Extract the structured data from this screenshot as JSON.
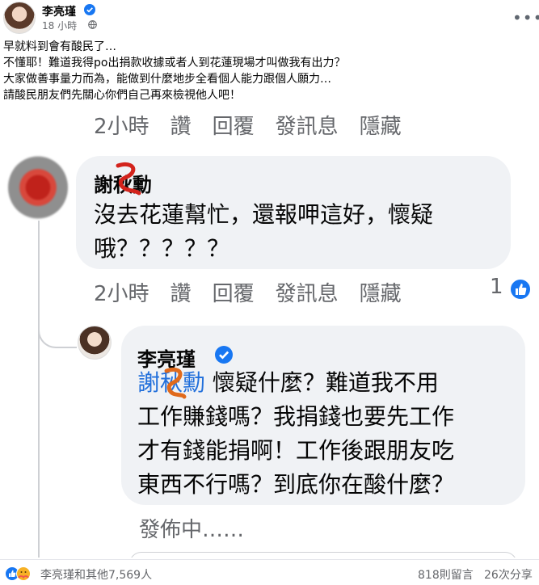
{
  "post": {
    "author": "李亮瑾",
    "time": "18 小時",
    "lines": [
      "早就料到會有酸民了…",
      "不懂耶！難道我得po出捐款收據或者人到花蓮現場才叫做我有出力？",
      "大家做善事量力而為，能做到什麼地步全看個人能力跟個人願力…",
      "請酸民朋友們先關心你們自己再來檢視他人吧！"
    ]
  },
  "screenshot": {
    "meta_row_1": [
      "2小時",
      "讚",
      "回覆",
      "發訊息",
      "隱藏"
    ],
    "comment": {
      "name": "謝秋勳",
      "lines": [
        "沒去花蓮幫忙，還報呷這好，懷疑",
        "哦？？？？？"
      ]
    },
    "meta_row_2": [
      "2小時",
      "讚",
      "回覆",
      "發訊息",
      "隱藏"
    ],
    "like_count": "1",
    "reply": {
      "name": "李亮瑾",
      "mention": "謝秋勳",
      "line1_rest": " 懷疑什麼？難道我不用",
      "lines": [
        "工作賺錢嗎？我捐錢也要先工作",
        "才有錢能捐啊！工作後跟朋友吃",
        "東西不行嗎？到底你在酸什麼？"
      ]
    },
    "posting_status": "發佈中……"
  },
  "footer": {
    "reactions_text": "李亮瑾和其他7,569人",
    "comments": "818則留言",
    "shares": "26次分享"
  },
  "colors": {
    "accent": "#1877f2",
    "mention": "#216fdb",
    "muted": "#65676b",
    "bubble": "#f0f2f5"
  },
  "icons": [
    "verified-badge-icon",
    "globe-icon",
    "more-options-icon",
    "like-reaction-icon",
    "care-reaction-icon"
  ]
}
